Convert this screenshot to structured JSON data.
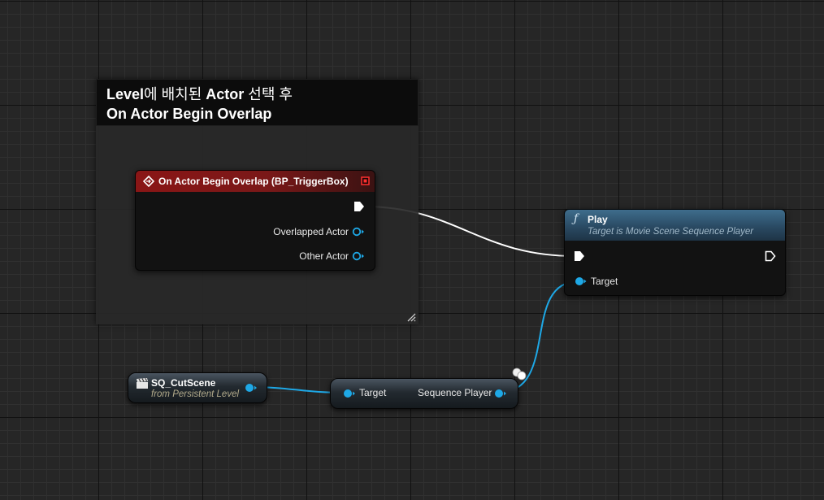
{
  "comment": {
    "line1_a": "Level",
    "line1_b": "에 배치된 ",
    "line1_c": "Actor",
    "line1_d": " 선택 후",
    "line2": "On Actor Begin Overlap"
  },
  "event_node": {
    "title": "On Actor Begin Overlap (BP_TriggerBox)",
    "pins": [
      "Overlapped Actor",
      "Other Actor"
    ]
  },
  "play_node": {
    "title": "Play",
    "subtitle": "Target is Movie Scene Sequence Player",
    "target_pin": "Target"
  },
  "cutscene_node": {
    "name": "SQ_CutScene",
    "subtitle": "from Persistent Level"
  },
  "sequence_player_node": {
    "input_pin": "Target",
    "output_pin": "Sequence Player"
  },
  "colors": {
    "exec_wire": "#ffffff",
    "object_pin": "#1ea8e6",
    "event_header": "#8a1616",
    "function_header": "#3f6d8c"
  }
}
